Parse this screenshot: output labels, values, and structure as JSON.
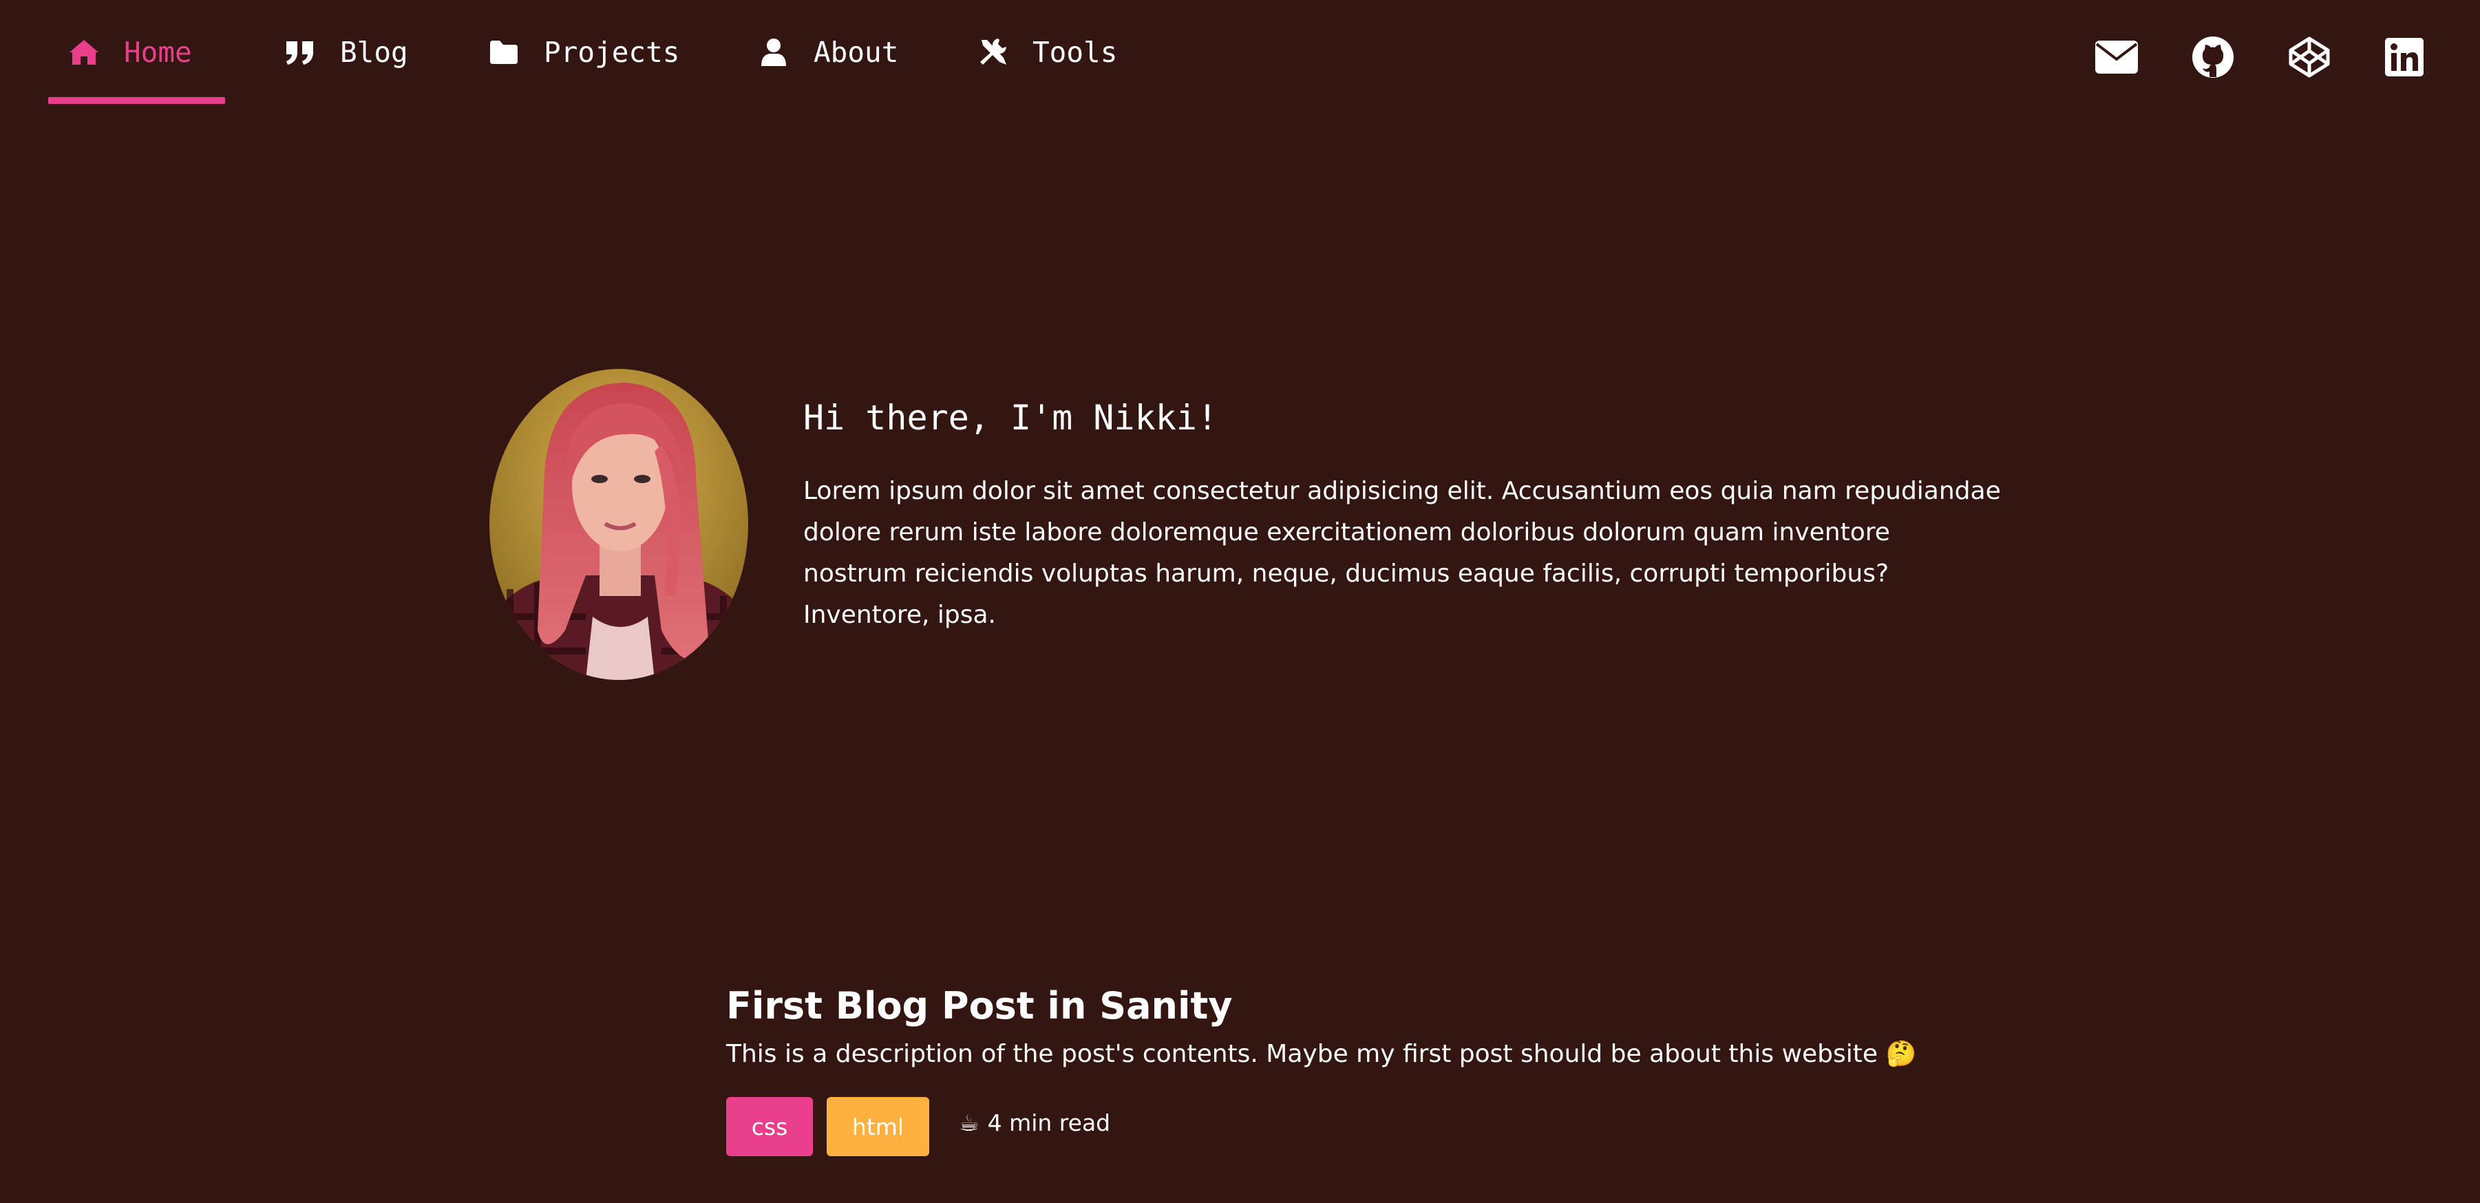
{
  "nav": {
    "items": [
      {
        "label": "Home",
        "icon": "home-icon",
        "active": true
      },
      {
        "label": "Blog",
        "icon": "quote-icon",
        "active": false
      },
      {
        "label": "Projects",
        "icon": "folder-icon",
        "active": false
      },
      {
        "label": "About",
        "icon": "user-icon",
        "active": false
      },
      {
        "label": "Tools",
        "icon": "tools-icon",
        "active": false
      }
    ],
    "social": [
      "envelope-icon",
      "github-icon",
      "codepen-icon",
      "linkedin-icon"
    ]
  },
  "hero": {
    "title": "Hi there, I'm Nikki!",
    "text": "Lorem ipsum dolor sit amet consectetur adipisicing elit. Accusantium eos quia nam repudiandae dolore rerum iste labore doloremque exercitationem doloribus dolorum quam inventore nostrum reiciendis voluptas harum, neque, ducimus eaque facilis, corrupti temporibus? Inventore, ipsa."
  },
  "post": {
    "title": "First Blog Post in Sanity",
    "description": "This is a description of the post's contents. Maybe my first post should be about this website 🤔",
    "tags": [
      {
        "label": "css",
        "color": "#e83e8c"
      },
      {
        "label": "html",
        "color": "#ffb140"
      }
    ],
    "read_time_icon": "☕",
    "read_time": "4 min read"
  },
  "colors": {
    "background": "#331612",
    "accent": "#e83e8c",
    "tag_html": "#ffb140"
  }
}
